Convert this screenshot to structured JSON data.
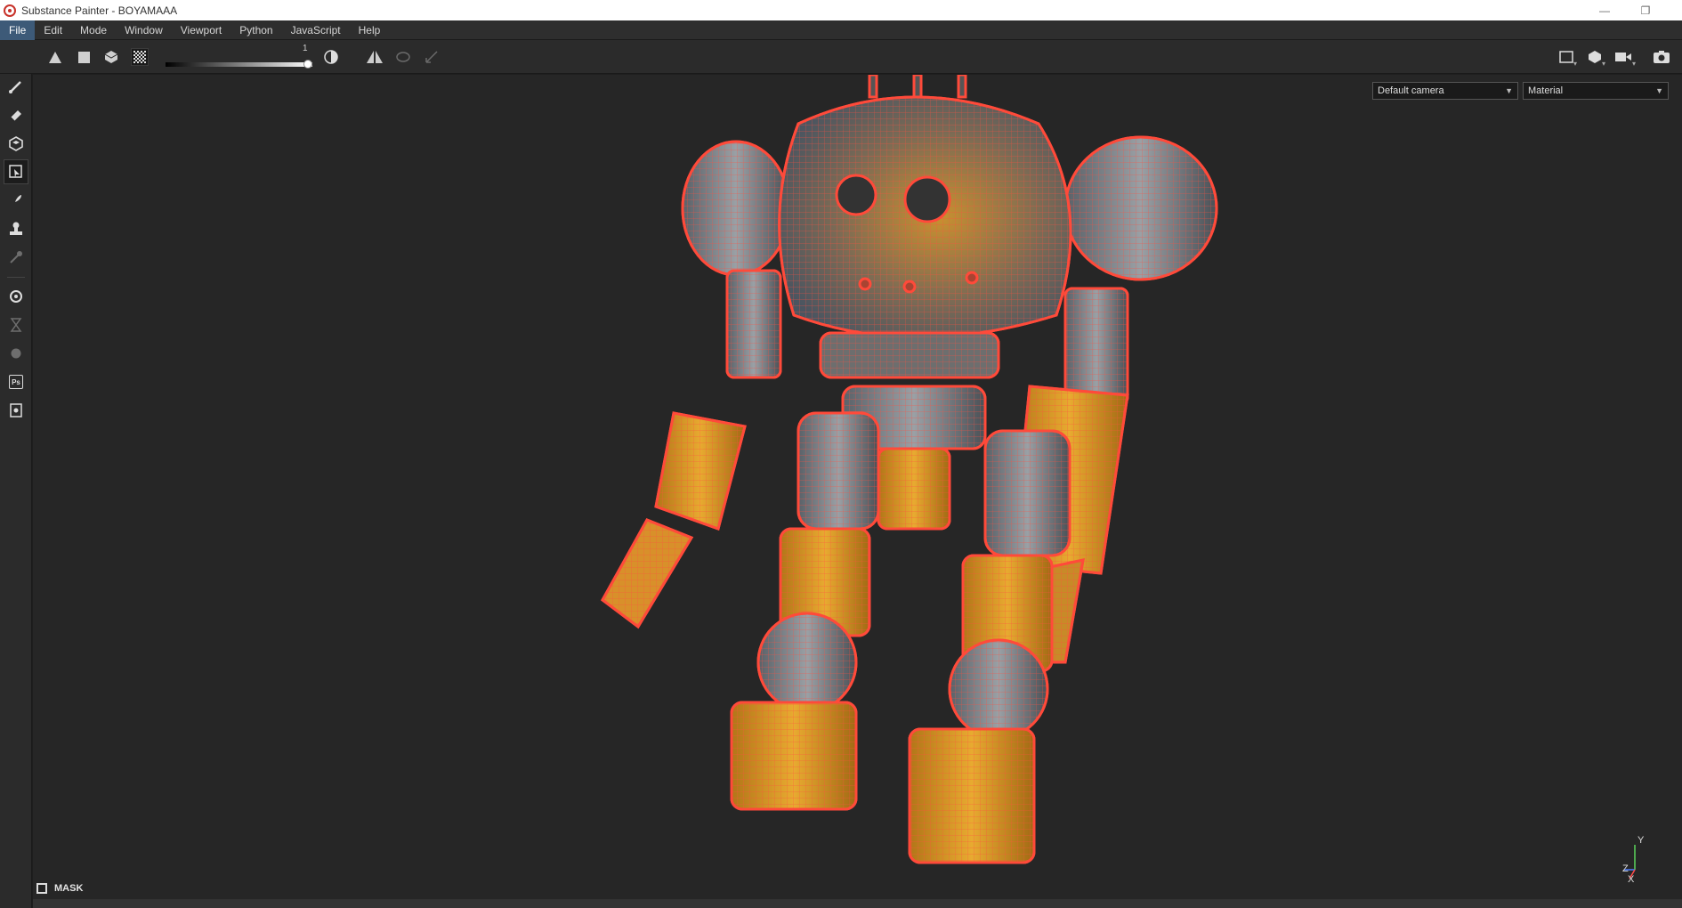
{
  "window": {
    "title": "Substance Painter - BOYAMAAA",
    "minimize_glyph": "—",
    "restore_glyph": "❐"
  },
  "menu": {
    "items": [
      {
        "label": "File",
        "active": true
      },
      {
        "label": "Edit"
      },
      {
        "label": "Mode"
      },
      {
        "label": "Window"
      },
      {
        "label": "Viewport"
      },
      {
        "label": "Python"
      },
      {
        "label": "JavaScript"
      },
      {
        "label": "Help"
      }
    ]
  },
  "toolbar": {
    "slider_value": "1",
    "slider_level": 1.0,
    "icons": [
      "triangle-fill-icon",
      "square-fill-icon",
      "cube-icon",
      "checker-icon",
      "contrast-icon",
      "symmetry-icon",
      "lazy-mouse-icon",
      "sticky-icon",
      "viewport-layout-icon",
      "3d-view-icon",
      "camera-video-icon",
      "screenshot-icon"
    ]
  },
  "left_tools": [
    "paint-brush-icon",
    "eraser-icon",
    "projection-icon",
    "polygon-fill-icon",
    "smudge-icon",
    "clone-stamp-icon",
    "color-picker-icon",
    "bake-icon",
    "hourglass-icon",
    "material-ball-icon",
    "photoshop-export-icon",
    "document-export-icon"
  ],
  "viewport": {
    "camera_select": "Default camera",
    "shading_select": "Material",
    "mask_label": "MASK",
    "axis": {
      "x": "X",
      "y": "Y",
      "z": "Z"
    }
  },
  "colors": {
    "wireframe": "#ff4a3a",
    "yellow_paint": "#e4a52a",
    "metal": "#6e7478",
    "accent_menu": "#3d5a78"
  }
}
